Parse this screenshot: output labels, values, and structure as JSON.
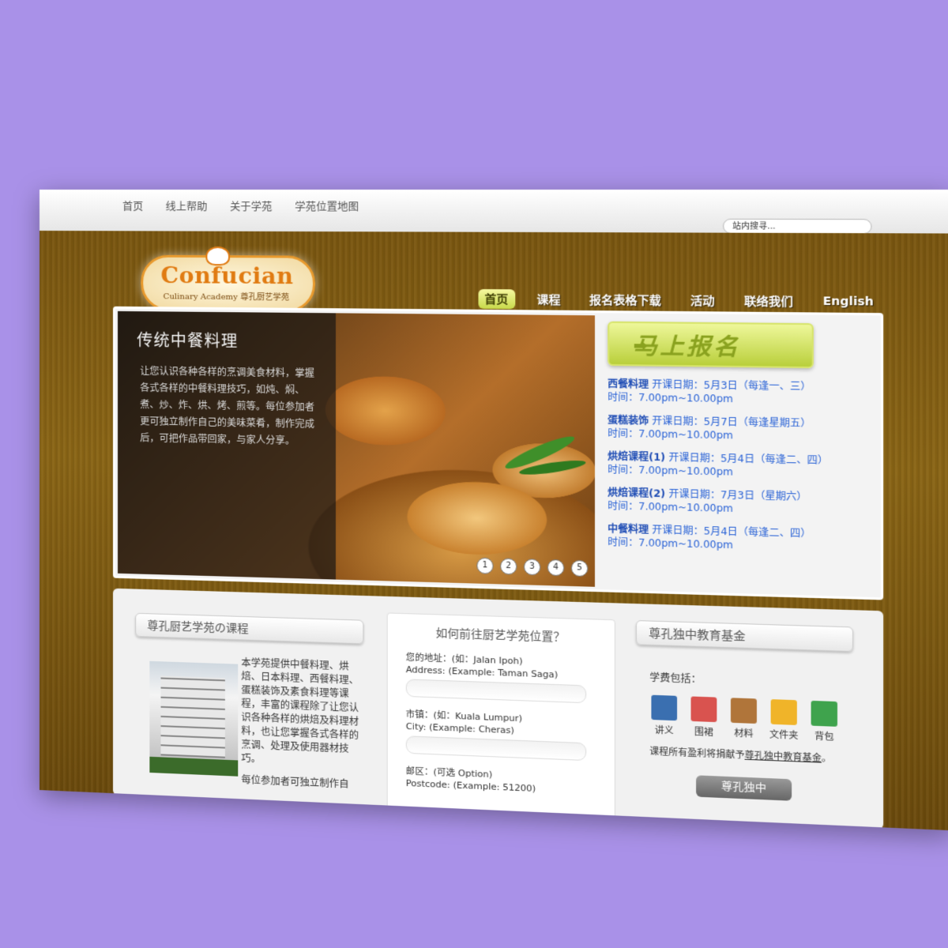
{
  "top_links": [
    "首页",
    "线上帮助",
    "关于学苑",
    "学苑位置地图"
  ],
  "search": {
    "placeholder": "站内搜寻..."
  },
  "logo": {
    "title": "Confucian",
    "subtitle": "Culinary Academy 尊孔厨艺学苑"
  },
  "main_nav": [
    {
      "label": "首页",
      "active": true
    },
    {
      "label": "课程",
      "active": false
    },
    {
      "label": "报名表格下载",
      "active": false
    },
    {
      "label": "活动",
      "active": false
    },
    {
      "label": "联络我们",
      "active": false
    },
    {
      "label": "English",
      "active": false
    }
  ],
  "hero": {
    "title": "传统中餐料理",
    "text": "让您认识各种各样的烹调美食材料，掌握各式各样的中餐料理技巧，如炖、焖、煮、炒、炸、烘、烤、煎等。每位参加者更可独立制作自己的美味菜肴，制作完成后，可把作品带回家，与家人分享。",
    "dots": [
      "1",
      "2",
      "3",
      "4",
      "5"
    ]
  },
  "signup": {
    "label": "马上报名",
    "arrow": "➡"
  },
  "courses": [
    {
      "name": "西餐料理",
      "start": "开课日期：5月3日（每逢一、三）",
      "time": "时间：7.00pm~10.00pm"
    },
    {
      "name": "蛋糕装饰",
      "start": "开课日期：5月7日（每逢星期五）",
      "time": "时间：7.00pm~10.00pm"
    },
    {
      "name": "烘焙课程(1)",
      "start": "开课日期：5月4日（每逢二、四）",
      "time": "时间：7.00pm~10.00pm"
    },
    {
      "name": "烘焙课程(2)",
      "start": "开课日期：7月3日（星期六）",
      "time": "时间：7.00pm~10.00pm"
    },
    {
      "name": "中餐料理",
      "start": "开课日期：5月4日（每逢二、四）",
      "time": "时间：7.00pm~10.00pm"
    }
  ],
  "col1": {
    "title": "尊孔厨艺学苑の课程",
    "text": "本学苑提供中餐料理、烘焙、日本料理、西餐料理、蛋糕装饰及素食料理等课程，丰富的课程除了让您认识各种各样的烘焙及料理材料，也让您掌握各式各样的烹调、处理及使用器材技巧。",
    "text2": "每位参加者可独立制作自"
  },
  "col2": {
    "title": "如何前往厨艺学苑位置？",
    "fields": [
      {
        "label": "您的地址：(如：Jalan Ipoh)",
        "hint": "Address: (Example: Taman Saga)"
      },
      {
        "label": "市镇：(如：Kuala Lumpur)",
        "hint": "City: (Example: Cheras)"
      },
      {
        "label": "邮区：(可选 Option)",
        "hint": "Postcode: (Example: 51200)"
      }
    ]
  },
  "col3": {
    "title": "尊孔独中教育基金",
    "fee_label": "学费包括：",
    "items": [
      {
        "label": "讲义",
        "icon": "book-icon",
        "color": "#3a6fb0"
      },
      {
        "label": "围裙",
        "icon": "calendar-add-icon",
        "color": "#d9534f"
      },
      {
        "label": "材料",
        "icon": "box-icon",
        "color": "#b0753a"
      },
      {
        "label": "文件夹",
        "icon": "folder-icon",
        "color": "#f0b429"
      },
      {
        "label": "背包",
        "icon": "bag-icon",
        "color": "#3fa34d"
      }
    ],
    "note_prefix": "课程所有盈利将捐献予",
    "note_link": "尊孔独中教育基金",
    "note_suffix": "。",
    "button": "尊孔独中"
  }
}
